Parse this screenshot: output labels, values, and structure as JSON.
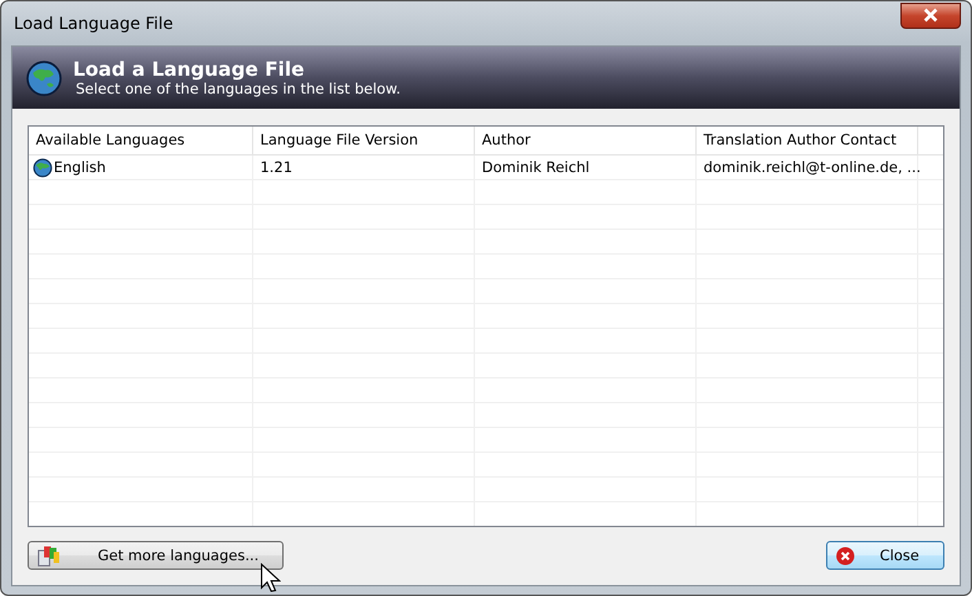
{
  "window": {
    "title": "Load Language File"
  },
  "header": {
    "title": "Load a Language File",
    "subtitle": "Select one of the languages in the list below."
  },
  "table": {
    "columns": [
      "Available Languages",
      "Language File Version",
      "Author",
      "Translation Author Contact"
    ],
    "rows": [
      {
        "cells": [
          "English",
          "1.21",
          "Dominik Reichl",
          "dominik.reichl@t-online.de, ..."
        ],
        "selected": false
      }
    ]
  },
  "buttons": [
    {
      "kind": "more",
      "label": "Get more languages..."
    },
    {
      "kind": "close",
      "label": "Close"
    }
  ]
}
